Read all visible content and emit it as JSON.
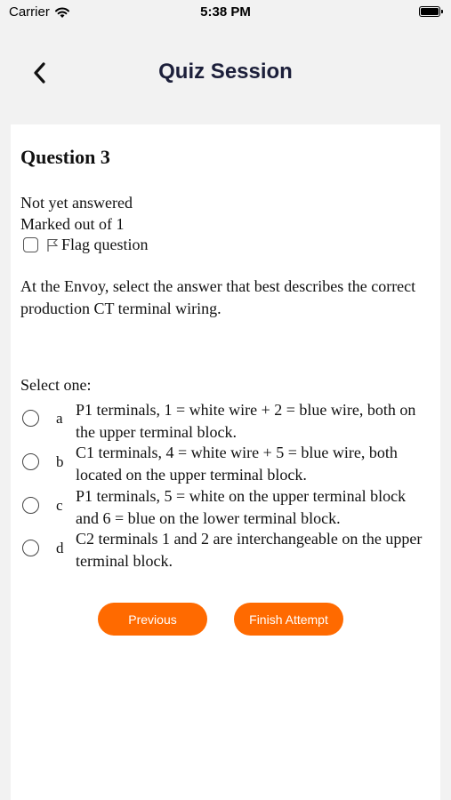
{
  "status_bar": {
    "carrier": "Carrier",
    "time": "5:38 PM"
  },
  "header": {
    "title": "Quiz Session",
    "back_icon": "chevron-left-icon"
  },
  "question": {
    "title": "Question 3",
    "state": "Not yet answered",
    "marks": "Marked out of 1",
    "flag_label": "Flag question",
    "text": "At the Envoy, select the answer that best describes the correct production CT terminal wiring.",
    "prompt": "Select one:",
    "options": [
      {
        "letter": "a",
        "text": "P1 terminals, 1 = white wire + 2 = blue wire, both on the upper terminal block."
      },
      {
        "letter": "b",
        "text": "C1 terminals, 4 = white wire + 5 = blue wire, both located on the upper terminal block."
      },
      {
        "letter": "c",
        "text": "P1 terminals, 5 = white on the upper terminal block and 6 = blue on the lower terminal block."
      },
      {
        "letter": "d",
        "text": "C2 terminals 1 and 2 are interchangeable on the upper terminal block."
      }
    ]
  },
  "buttons": {
    "previous": "Previous",
    "finish": "Finish Attempt"
  },
  "colors": {
    "accent": "#ff6a00",
    "title": "#1c1f3a",
    "background": "#f2f2f2"
  }
}
